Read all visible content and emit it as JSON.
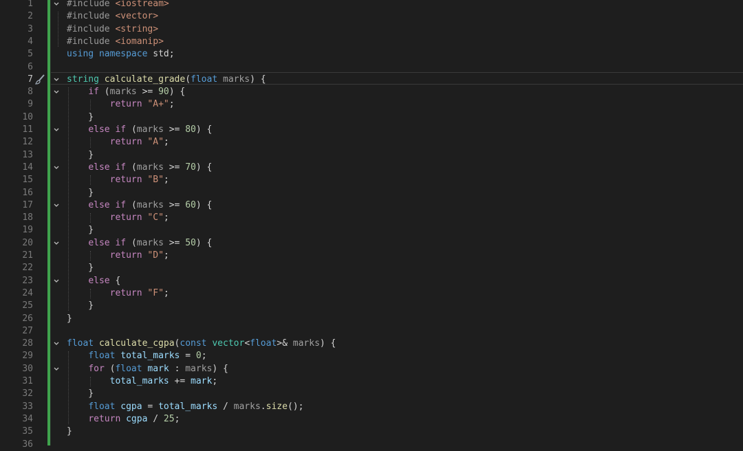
{
  "editor": {
    "language": "cpp",
    "active_line": 7,
    "lines": [
      {
        "n": "1",
        "fold": "v",
        "tokens": [
          [
            "pp",
            "#include "
          ],
          [
            "inc",
            "<iostream>"
          ]
        ]
      },
      {
        "n": "2",
        "fold": "",
        "tokens": [
          [
            "pp",
            "#include "
          ],
          [
            "inc",
            "<vector>"
          ]
        ]
      },
      {
        "n": "3",
        "fold": "",
        "tokens": [
          [
            "pp",
            "#include "
          ],
          [
            "inc",
            "<string>"
          ]
        ]
      },
      {
        "n": "4",
        "fold": "",
        "tokens": [
          [
            "pp",
            "#include "
          ],
          [
            "inc",
            "<iomanip>"
          ]
        ]
      },
      {
        "n": "5",
        "fold": "",
        "tokens": [
          [
            "kw",
            "using "
          ],
          [
            "kw",
            "namespace "
          ],
          [
            "punc",
            "std;"
          ]
        ]
      },
      {
        "n": "6",
        "fold": "",
        "tokens": []
      },
      {
        "n": "7",
        "fold": "v",
        "tokens": [
          [
            "ty",
            "string "
          ],
          [
            "fn",
            "calculate_grade"
          ],
          [
            "punc",
            "("
          ],
          [
            "kw",
            "float "
          ],
          [
            "param",
            "marks"
          ],
          [
            "punc",
            ") {"
          ]
        ]
      },
      {
        "n": "8",
        "fold": "v",
        "tokens": [
          [
            "punc",
            "    "
          ],
          [
            "ctl",
            "if "
          ],
          [
            "punc",
            "("
          ],
          [
            "param",
            "marks "
          ],
          [
            "punc",
            ">= "
          ],
          [
            "num",
            "90"
          ],
          [
            "punc",
            ") {"
          ]
        ]
      },
      {
        "n": "9",
        "fold": "",
        "tokens": [
          [
            "punc",
            "        "
          ],
          [
            "ctl",
            "return "
          ],
          [
            "str",
            "\"A+\""
          ],
          [
            "punc",
            ";"
          ]
        ]
      },
      {
        "n": "10",
        "fold": "",
        "tokens": [
          [
            "punc",
            "    }"
          ]
        ]
      },
      {
        "n": "11",
        "fold": "v",
        "tokens": [
          [
            "punc",
            "    "
          ],
          [
            "ctl",
            "else if "
          ],
          [
            "punc",
            "("
          ],
          [
            "param",
            "marks "
          ],
          [
            "punc",
            ">= "
          ],
          [
            "num",
            "80"
          ],
          [
            "punc",
            ") {"
          ]
        ]
      },
      {
        "n": "12",
        "fold": "",
        "tokens": [
          [
            "punc",
            "        "
          ],
          [
            "ctl",
            "return "
          ],
          [
            "str",
            "\"A\""
          ],
          [
            "punc",
            ";"
          ]
        ]
      },
      {
        "n": "13",
        "fold": "",
        "tokens": [
          [
            "punc",
            "    }"
          ]
        ]
      },
      {
        "n": "14",
        "fold": "v",
        "tokens": [
          [
            "punc",
            "    "
          ],
          [
            "ctl",
            "else if "
          ],
          [
            "punc",
            "("
          ],
          [
            "param",
            "marks "
          ],
          [
            "punc",
            ">= "
          ],
          [
            "num",
            "70"
          ],
          [
            "punc",
            ") {"
          ]
        ]
      },
      {
        "n": "15",
        "fold": "",
        "tokens": [
          [
            "punc",
            "        "
          ],
          [
            "ctl",
            "return "
          ],
          [
            "str",
            "\"B\""
          ],
          [
            "punc",
            ";"
          ]
        ]
      },
      {
        "n": "16",
        "fold": "",
        "tokens": [
          [
            "punc",
            "    }"
          ]
        ]
      },
      {
        "n": "17",
        "fold": "v",
        "tokens": [
          [
            "punc",
            "    "
          ],
          [
            "ctl",
            "else if "
          ],
          [
            "punc",
            "("
          ],
          [
            "param",
            "marks "
          ],
          [
            "punc",
            ">= "
          ],
          [
            "num",
            "60"
          ],
          [
            "punc",
            ") {"
          ]
        ]
      },
      {
        "n": "18",
        "fold": "",
        "tokens": [
          [
            "punc",
            "        "
          ],
          [
            "ctl",
            "return "
          ],
          [
            "str",
            "\"C\""
          ],
          [
            "punc",
            ";"
          ]
        ]
      },
      {
        "n": "19",
        "fold": "",
        "tokens": [
          [
            "punc",
            "    }"
          ]
        ]
      },
      {
        "n": "20",
        "fold": "v",
        "tokens": [
          [
            "punc",
            "    "
          ],
          [
            "ctl",
            "else if "
          ],
          [
            "punc",
            "("
          ],
          [
            "param",
            "marks "
          ],
          [
            "punc",
            ">= "
          ],
          [
            "num",
            "50"
          ],
          [
            "punc",
            ") {"
          ]
        ]
      },
      {
        "n": "21",
        "fold": "",
        "tokens": [
          [
            "punc",
            "        "
          ],
          [
            "ctl",
            "return "
          ],
          [
            "str",
            "\"D\""
          ],
          [
            "punc",
            ";"
          ]
        ]
      },
      {
        "n": "22",
        "fold": "",
        "tokens": [
          [
            "punc",
            "    }"
          ]
        ]
      },
      {
        "n": "23",
        "fold": "v",
        "tokens": [
          [
            "punc",
            "    "
          ],
          [
            "ctl",
            "else "
          ],
          [
            "punc",
            "{"
          ]
        ]
      },
      {
        "n": "24",
        "fold": "",
        "tokens": [
          [
            "punc",
            "        "
          ],
          [
            "ctl",
            "return "
          ],
          [
            "str",
            "\"F\""
          ],
          [
            "punc",
            ";"
          ]
        ]
      },
      {
        "n": "25",
        "fold": "",
        "tokens": [
          [
            "punc",
            "    }"
          ]
        ]
      },
      {
        "n": "26",
        "fold": "",
        "tokens": [
          [
            "punc",
            "}"
          ]
        ]
      },
      {
        "n": "27",
        "fold": "",
        "tokens": []
      },
      {
        "n": "28",
        "fold": "v",
        "tokens": [
          [
            "kw",
            "float "
          ],
          [
            "fn",
            "calculate_cgpa"
          ],
          [
            "punc",
            "("
          ],
          [
            "kw",
            "const "
          ],
          [
            "ty",
            "vector"
          ],
          [
            "punc",
            "<"
          ],
          [
            "kw",
            "float"
          ],
          [
            "punc",
            ">& "
          ],
          [
            "param",
            "marks"
          ],
          [
            "punc",
            ") {"
          ]
        ]
      },
      {
        "n": "29",
        "fold": "",
        "tokens": [
          [
            "punc",
            "    "
          ],
          [
            "kw",
            "float "
          ],
          [
            "var",
            "total_marks "
          ],
          [
            "punc",
            "= "
          ],
          [
            "num",
            "0"
          ],
          [
            "punc",
            ";"
          ]
        ]
      },
      {
        "n": "30",
        "fold": "v",
        "tokens": [
          [
            "punc",
            "    "
          ],
          [
            "ctl",
            "for "
          ],
          [
            "punc",
            "("
          ],
          [
            "kw",
            "float "
          ],
          [
            "var",
            "mark "
          ],
          [
            "punc",
            ": "
          ],
          [
            "param",
            "marks"
          ],
          [
            "punc",
            ") {"
          ]
        ]
      },
      {
        "n": "31",
        "fold": "",
        "tokens": [
          [
            "punc",
            "        "
          ],
          [
            "var",
            "total_marks "
          ],
          [
            "punc",
            "+= "
          ],
          [
            "var",
            "mark"
          ],
          [
            "punc",
            ";"
          ]
        ]
      },
      {
        "n": "32",
        "fold": "",
        "tokens": [
          [
            "punc",
            "    }"
          ]
        ]
      },
      {
        "n": "33",
        "fold": "",
        "tokens": [
          [
            "punc",
            "    "
          ],
          [
            "kw",
            "float "
          ],
          [
            "var",
            "cgpa "
          ],
          [
            "punc",
            "= "
          ],
          [
            "var",
            "total_marks "
          ],
          [
            "punc",
            "/ "
          ],
          [
            "param",
            "marks"
          ],
          [
            "punc",
            "."
          ],
          [
            "fn",
            "size"
          ],
          [
            "punc",
            "();"
          ]
        ]
      },
      {
        "n": "34",
        "fold": "",
        "tokens": [
          [
            "punc",
            "    "
          ],
          [
            "ctl",
            "return "
          ],
          [
            "var",
            "cgpa "
          ],
          [
            "punc",
            "/ "
          ],
          [
            "num",
            "25"
          ],
          [
            "punc",
            ";"
          ]
        ]
      },
      {
        "n": "35",
        "fold": "",
        "tokens": [
          [
            "punc",
            "}"
          ]
        ]
      },
      {
        "n": "36",
        "fold": "",
        "tokens": []
      }
    ]
  },
  "icons": {
    "fold_open": "chevron-down-icon",
    "quick_action": "paintbrush-icon"
  },
  "colors": {
    "background": "#1e1e1e",
    "change_bar": "#3fa34d"
  }
}
